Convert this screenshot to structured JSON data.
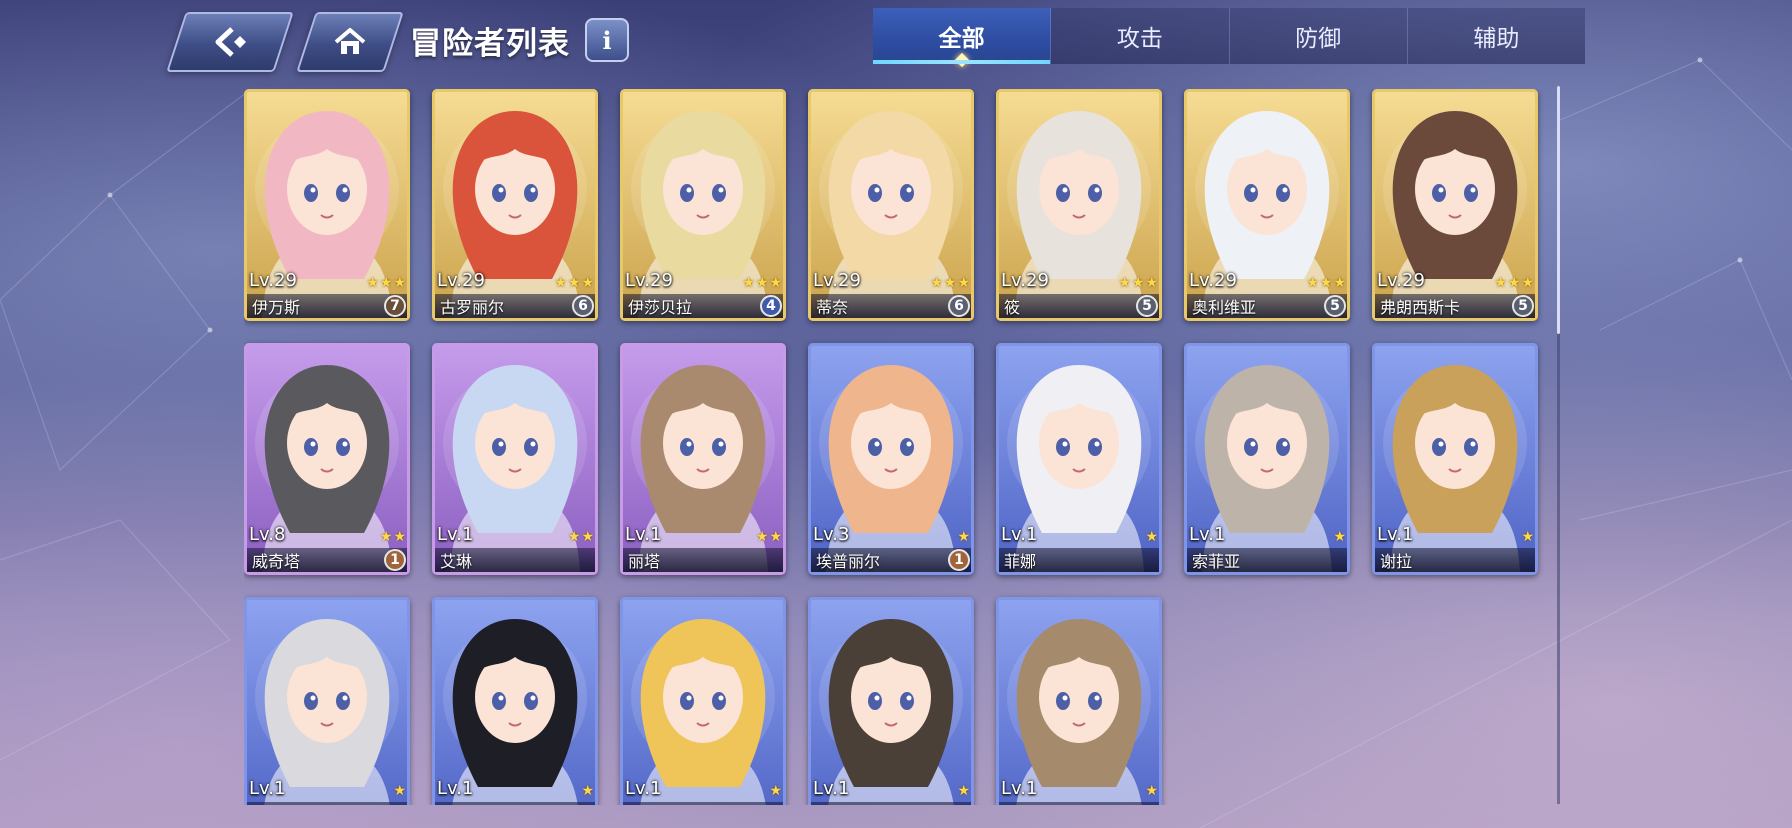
{
  "header": {
    "title": "冒险者列表",
    "info_label": "i",
    "tabs": [
      {
        "label": "全部",
        "active": true
      },
      {
        "label": "攻击",
        "active": false
      },
      {
        "label": "防御",
        "active": false
      },
      {
        "label": "辅助",
        "active": false
      }
    ]
  },
  "icons": {
    "back": "back-arrow-icon",
    "home": "home-icon",
    "info": "info-icon"
  },
  "colors": {
    "gold_frame": "#e8c96a",
    "purple_frame": "#c79be6",
    "blue_frame": "#7f96e8",
    "star": "#ffd84a",
    "tab_active": "#2c4a9e",
    "tab_indicator": "#6fd6ff"
  },
  "cards": [
    {
      "name": "伊万斯",
      "level": "Lv.29",
      "stars": 3,
      "badge": "7",
      "rarity": "gold",
      "hair": "#f1b7c2"
    },
    {
      "name": "古罗丽尔",
      "level": "Lv.29",
      "stars": 3,
      "badge": "6",
      "rarity": "gold",
      "hair": "#d9543a"
    },
    {
      "name": "伊莎贝拉",
      "level": "Lv.29",
      "stars": 3,
      "badge": "4",
      "rarity": "gold",
      "hair": "#e9dba0"
    },
    {
      "name": "蒂奈",
      "level": "Lv.29",
      "stars": 3,
      "badge": "6",
      "rarity": "gold",
      "hair": "#f3d9a5"
    },
    {
      "name": "筱",
      "level": "Lv.29",
      "stars": 3,
      "badge": "5",
      "rarity": "gold",
      "hair": "#e8e2dc"
    },
    {
      "name": "奥利维亚",
      "level": "Lv.29",
      "stars": 3,
      "badge": "5",
      "rarity": "gold",
      "hair": "#eef2f6"
    },
    {
      "name": "弗朗西斯卡",
      "level": "Lv.29",
      "stars": 3,
      "badge": "5",
      "rarity": "gold",
      "hair": "#6b4a3c"
    },
    {
      "name": "威奇塔",
      "level": "Lv.8",
      "stars": 2,
      "badge": "1",
      "rarity": "purple",
      "hair": "#5a5a5e"
    },
    {
      "name": "艾琳",
      "level": "Lv.1",
      "stars": 2,
      "badge": "",
      "rarity": "purple",
      "hair": "#c9d8f2"
    },
    {
      "name": "丽塔",
      "level": "Lv.1",
      "stars": 2,
      "badge": "",
      "rarity": "purple",
      "hair": "#a98a6e"
    },
    {
      "name": "埃普丽尔",
      "level": "Lv.3",
      "stars": 1,
      "badge": "1",
      "rarity": "blue",
      "hair": "#efb58d"
    },
    {
      "name": "菲娜",
      "level": "Lv.1",
      "stars": 1,
      "badge": "",
      "rarity": "blue",
      "hair": "#f0f0f4"
    },
    {
      "name": "索菲亚",
      "level": "Lv.1",
      "stars": 1,
      "badge": "",
      "rarity": "blue",
      "hair": "#bdb3a8"
    },
    {
      "name": "谢拉",
      "level": "Lv.1",
      "stars": 1,
      "badge": "",
      "rarity": "blue",
      "hair": "#c9a15a"
    },
    {
      "name": "",
      "level": "Lv.1",
      "stars": 1,
      "badge": "",
      "rarity": "blue",
      "hair": "#d9d9de"
    },
    {
      "name": "",
      "level": "Lv.1",
      "stars": 1,
      "badge": "",
      "rarity": "blue",
      "hair": "#1e1e26"
    },
    {
      "name": "",
      "level": "Lv.1",
      "stars": 1,
      "badge": "",
      "rarity": "blue",
      "hair": "#efc55a"
    },
    {
      "name": "",
      "level": "Lv.1",
      "stars": 1,
      "badge": "",
      "rarity": "blue",
      "hair": "#4a4038"
    },
    {
      "name": "",
      "level": "Lv.1",
      "stars": 1,
      "badge": "",
      "rarity": "blue",
      "hair": "#a58a6c"
    }
  ]
}
